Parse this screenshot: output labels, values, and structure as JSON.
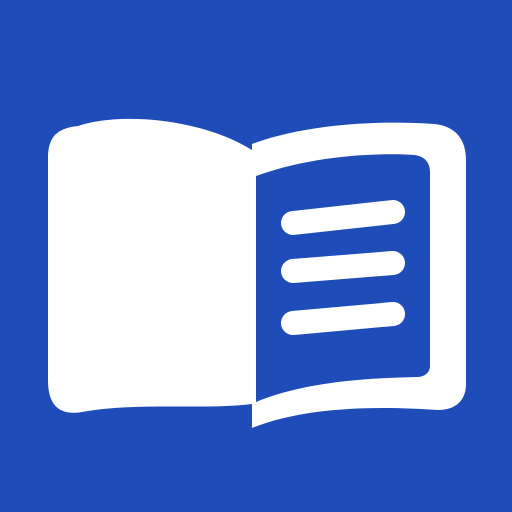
{
  "app_icon": {
    "icon_name": "open-book-reader-icon",
    "colors": {
      "background": "#1E4CB8",
      "foreground": "#FFFFFF"
    },
    "text_lines_on_page": 3
  }
}
